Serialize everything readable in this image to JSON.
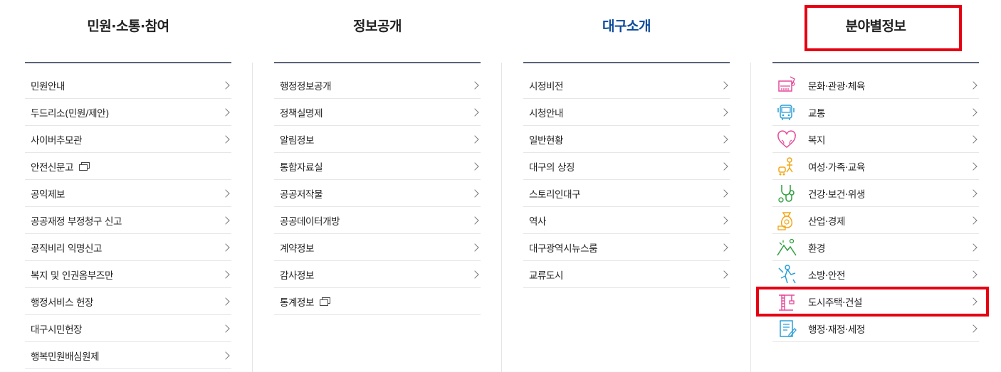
{
  "columns": [
    {
      "title": "민원·소통·참여",
      "items": [
        {
          "label": "민원안내"
        },
        {
          "label": "두드리소(민원/제안)"
        },
        {
          "label": "사이버추모관"
        },
        {
          "label": "안전신문고",
          "new_window": true
        },
        {
          "label": "공익제보"
        },
        {
          "label": "공공재정 부정청구 신고"
        },
        {
          "label": "공직비리 익명신고"
        },
        {
          "label": "복지 및 인권옴부즈만"
        },
        {
          "label": "행정서비스 헌장"
        },
        {
          "label": "대구시민헌장"
        },
        {
          "label": "행복민원배심원제"
        }
      ]
    },
    {
      "title": "정보공개",
      "items": [
        {
          "label": "행정정보공개"
        },
        {
          "label": "정책실명제"
        },
        {
          "label": "알림정보"
        },
        {
          "label": "통합자료실"
        },
        {
          "label": "공공저작물"
        },
        {
          "label": "공공데이터개방"
        },
        {
          "label": "계약정보"
        },
        {
          "label": "감사정보"
        },
        {
          "label": "통계정보",
          "new_window": true
        }
      ]
    },
    {
      "title": "대구소개",
      "active": true,
      "items": [
        {
          "label": "시정비전"
        },
        {
          "label": "시청안내"
        },
        {
          "label": "일반현황"
        },
        {
          "label": "대구의 상징"
        },
        {
          "label": "스토리인대구"
        },
        {
          "label": "역사"
        },
        {
          "label": "대구광역시뉴스룸"
        },
        {
          "label": "교류도시"
        }
      ]
    },
    {
      "title": "분야별정보",
      "highlighted": true,
      "items": [
        {
          "label": "문화·관광·체육",
          "icon": "culture-icon"
        },
        {
          "label": "교통",
          "icon": "bus-icon"
        },
        {
          "label": "복지",
          "icon": "heart-icon"
        },
        {
          "label": "여성·가족·교육",
          "icon": "family-icon"
        },
        {
          "label": "건강·보건·위생",
          "icon": "stethoscope-icon"
        },
        {
          "label": "산업·경제",
          "icon": "money-bag-icon"
        },
        {
          "label": "환경",
          "icon": "mountain-icon"
        },
        {
          "label": "소방·안전",
          "icon": "firefighter-icon"
        },
        {
          "label": "도시주택·건설",
          "icon": "crane-icon",
          "highlighted": true
        },
        {
          "label": "행정·재정·세정",
          "icon": "document-icon"
        }
      ]
    }
  ],
  "colors": {
    "active_title": "#0b4a9b",
    "highlight_box": "#e60012",
    "header_rule": "#5a6478"
  }
}
